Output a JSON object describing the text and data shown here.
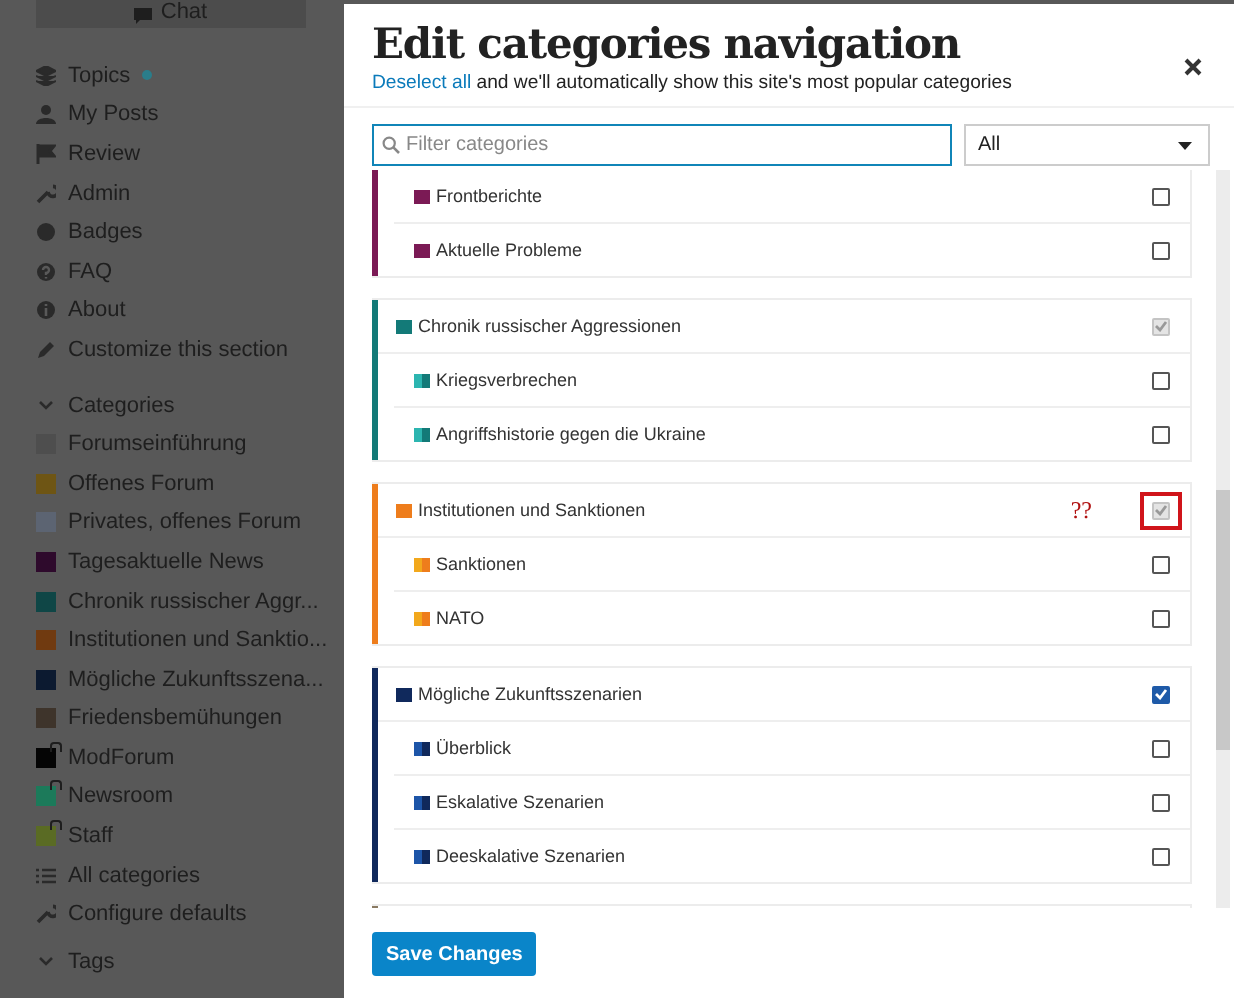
{
  "sidebar": {
    "chat_button": {
      "label": "Chat"
    },
    "nav": [
      {
        "kind": "topics",
        "label": "Topics",
        "unread_dot": true
      },
      {
        "kind": "posts",
        "label": "My Posts",
        "unread_dot": false
      },
      {
        "kind": "review",
        "label": "Review",
        "unread_dot": false
      },
      {
        "kind": "admin",
        "label": "Admin",
        "unread_dot": false
      },
      {
        "kind": "badges",
        "label": "Badges",
        "unread_dot": false
      },
      {
        "kind": "faq",
        "label": "FAQ",
        "unread_dot": false
      },
      {
        "kind": "about",
        "label": "About",
        "unread_dot": false
      },
      {
        "kind": "customize",
        "label": "Customize this section",
        "unread_dot": false
      }
    ],
    "categories_header": "Categories",
    "categories": [
      {
        "label": "Forumseinführung",
        "color": "#4e4e4e",
        "locked": false
      },
      {
        "label": "Offenes Forum",
        "color": "#6e5514",
        "locked": false
      },
      {
        "label": "Privates, offenes Forum",
        "color": "#5c6472",
        "locked": false
      },
      {
        "label": "Tagesaktuelle News",
        "color": "#2e0a2c",
        "locked": false
      },
      {
        "label": "Chronik russischer Aggr...",
        "color": "#0f4646",
        "locked": false
      },
      {
        "label": "Institutionen und Sanktio...",
        "color": "#703a10",
        "locked": false
      },
      {
        "label": "Mögliche Zukunftsszena...",
        "color": "#0c1a30",
        "locked": false
      },
      {
        "label": "Friedensbemühungen",
        "color": "#3e342b",
        "locked": false
      },
      {
        "label": "ModForum",
        "color": "#050505",
        "locked": true
      },
      {
        "label": "Newsroom",
        "color": "#1c7a5a",
        "locked": true
      },
      {
        "label": "Staff",
        "color": "#5a6b24",
        "locked": true
      }
    ],
    "footer_links": [
      {
        "kind": "list",
        "label": "All categories"
      },
      {
        "kind": "wrench",
        "label": "Configure defaults"
      }
    ],
    "tags_header": "Tags"
  },
  "modal": {
    "title": "Edit categories navigation",
    "subtitle_link": "Deselect all",
    "subtitle": "and we'll automatically show this site's most popular categories",
    "filter": {
      "placeholder": "Filter categories"
    },
    "scope_select": {
      "value": "All"
    },
    "groups": [
      {
        "color": "#7b1a55",
        "rows": [
          {
            "kind": "child",
            "label": "Frontberichte",
            "color": "#7b1a55",
            "checked": false,
            "disabled": false,
            "note": ""
          },
          {
            "kind": "child",
            "label": "Aktuelle Probleme",
            "color": "#7b1a55",
            "checked": false,
            "disabled": false,
            "note": ""
          }
        ]
      },
      {
        "color": "#137a78",
        "rows": [
          {
            "kind": "parent",
            "label": "Chronik russischer Aggressionen",
            "color": "#137a78",
            "checked": true,
            "disabled": true,
            "note": ""
          },
          {
            "kind": "child",
            "label": "Kriegsverbrechen",
            "color": "#2cb5b0",
            "checked": false,
            "disabled": false,
            "note": ""
          },
          {
            "kind": "child",
            "label": "Angriffshistorie gegen die Ukraine",
            "color": "#2cb5b0",
            "checked": false,
            "disabled": false,
            "note": ""
          }
        ]
      },
      {
        "color": "#ee7d1c",
        "rows": [
          {
            "kind": "parent",
            "label": "Institutionen und Sanktionen",
            "color": "#ee7d1c",
            "checked": true,
            "disabled": true,
            "note": "??"
          },
          {
            "kind": "child",
            "label": "Sanktionen",
            "color": "#f2a81c",
            "checked": false,
            "disabled": false,
            "note": ""
          },
          {
            "kind": "child",
            "label": "NATO",
            "color": "#f2a81c",
            "checked": false,
            "disabled": false,
            "note": ""
          }
        ]
      },
      {
        "color": "#10295c",
        "rows": [
          {
            "kind": "parent",
            "label": "Mögliche Zukunftsszenarien",
            "color": "#10295c",
            "checked": true,
            "disabled": false,
            "note": ""
          },
          {
            "kind": "child",
            "label": "Überblick",
            "color": "#1d55a8",
            "checked": false,
            "disabled": false,
            "note": ""
          },
          {
            "kind": "child",
            "label": "Eskalative Szenarien",
            "color": "#1d55a8",
            "checked": false,
            "disabled": false,
            "note": ""
          },
          {
            "kind": "child",
            "label": "Deeskalative Szenarien",
            "color": "#1d55a8",
            "checked": false,
            "disabled": false,
            "note": ""
          }
        ]
      },
      {
        "color": "#8a7a62"
      }
    ],
    "save_button": "Save Changes"
  }
}
